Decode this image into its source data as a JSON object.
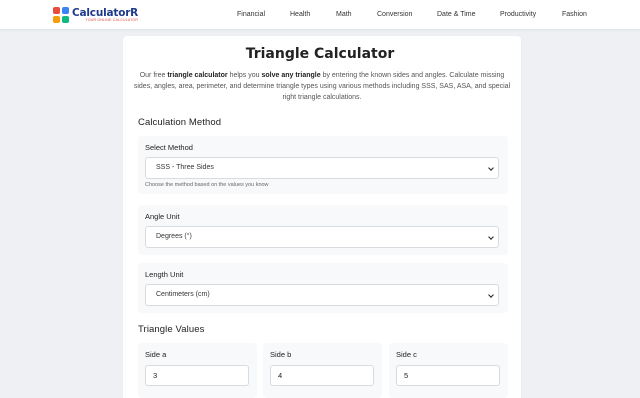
{
  "brand": {
    "name": "CalculatorR",
    "tagline": "YOUR ONLINE CALCULATOR",
    "logo_colors": [
      "#e74c3c",
      "#3b82f6",
      "#f59e0b",
      "#10b981"
    ]
  },
  "nav": {
    "items": [
      "Financial",
      "Health",
      "Math",
      "Conversion",
      "Date & Time",
      "Productivity",
      "Fashion"
    ]
  },
  "page": {
    "title": "Triangle Calculator",
    "intro": {
      "p1": "Our free ",
      "b1": "triangle calculator",
      "p2": " helps you ",
      "b2": "solve any triangle",
      "p3": " by entering the known sides and angles. Calculate missing sides, angles, area, perimeter, and determine triangle types using various methods including SSS, SAS, ASA, and special right triangle calculations."
    }
  },
  "method_section": {
    "title": "Calculation Method",
    "method": {
      "label": "Select Method",
      "value": "SSS - Three Sides",
      "help": "Choose the method based on the values you know"
    },
    "angle_unit": {
      "label": "Angle Unit",
      "value": "Degrees (°)"
    },
    "length_unit": {
      "label": "Length Unit",
      "value": "Centimeters (cm)"
    }
  },
  "values_section": {
    "title": "Triangle Values",
    "sides": [
      {
        "label": "Side a",
        "value": "3"
      },
      {
        "label": "Side b",
        "value": "4"
      },
      {
        "label": "Side c",
        "value": "5"
      }
    ]
  }
}
